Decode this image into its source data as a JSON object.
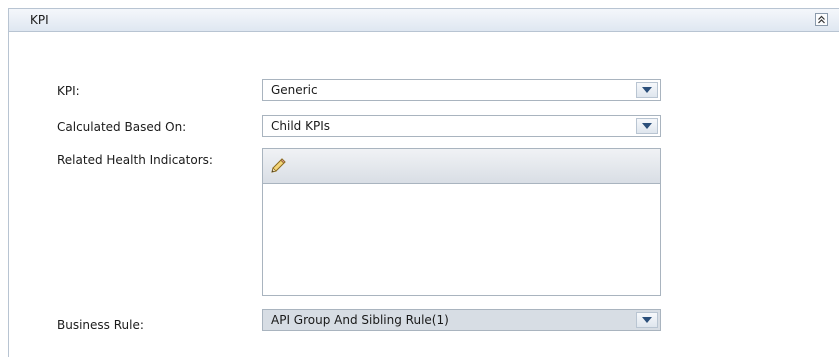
{
  "panel": {
    "title": "KPI"
  },
  "fields": {
    "kpi": {
      "label": "KPI:",
      "value": "Generic"
    },
    "calculated": {
      "label": "Calculated Based On:",
      "value": "Child KPIs"
    },
    "related": {
      "label": "Related Health Indicators:"
    },
    "business_rule": {
      "label": "Business Rule:",
      "value": "API Group And Sibling Rule(1)"
    }
  },
  "icons": {
    "collapse": "double-chevron-up-icon",
    "edit": "pencil-icon",
    "dropdown": "triangle-down-icon"
  },
  "colors": {
    "header_bg": "#dfe7f1",
    "border": "#a9b4bf",
    "arrow": "#2b4f7a"
  }
}
